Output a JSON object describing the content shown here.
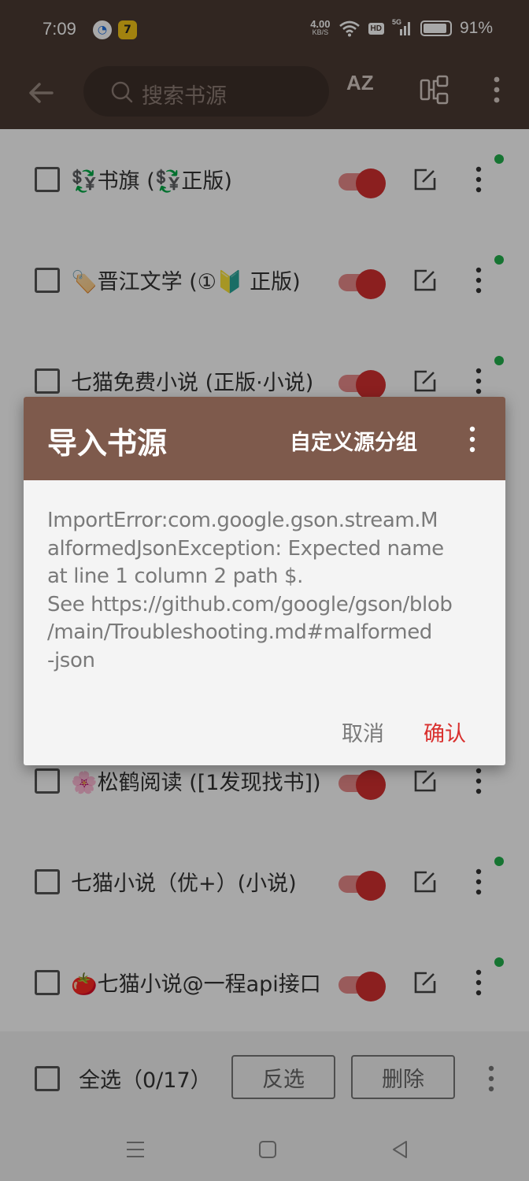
{
  "status_bar": {
    "time": "7:09",
    "net_speed_value": "4.00",
    "net_speed_unit": "KB/S",
    "hd_badge": "HD",
    "signal_badge": "5G",
    "battery_percent": "91%",
    "battery_level": 0.91
  },
  "toolbar": {
    "search_placeholder": "搜索书源",
    "sort_label": "AZ",
    "icons": {
      "back": "arrow-left-icon",
      "search": "search-icon",
      "group": "group-icon",
      "more": "more-vert-icon"
    }
  },
  "sources": [
    {
      "name": "💱书旗 (💱正版)",
      "enabled": true,
      "status_dot": true
    },
    {
      "name": "🏷️晋江文学 (①🔰 正版)",
      "enabled": true,
      "status_dot": true
    },
    {
      "name": "七猫免费小说 (正版·小说)",
      "enabled": true,
      "status_dot": true
    },
    {
      "name": "🌸松鹤阅读 ([1发现找书])",
      "enabled": true,
      "status_dot": false
    },
    {
      "name": "七猫小说（优+）(小说)",
      "enabled": true,
      "status_dot": true
    },
    {
      "name": "🍅七猫小说@一程api接口",
      "enabled": true,
      "status_dot": true
    }
  ],
  "bottom_bar": {
    "select_all_label": "全选（0/17）",
    "invert_label": "反选",
    "delete_label": "删除"
  },
  "dialog": {
    "title": "导入书源",
    "custom_group_label": "自定义源分组",
    "message": "ImportError:com.google.gson.stream.M\nalformedJsonException: Expected name\nat line 1 column 2 path $.\nSee https://github.com/google/gson/blob\n/main/Troubleshooting.md#malformed\n-json",
    "cancel_label": "取消",
    "confirm_label": "确认"
  },
  "colors": {
    "toolbar_bg": "#4b3a32",
    "dialog_header_bg": "#7e5a4c",
    "accent_red": "#d32f2f",
    "confirm_text": "#d9302e",
    "status_dot": "#22b14c"
  }
}
